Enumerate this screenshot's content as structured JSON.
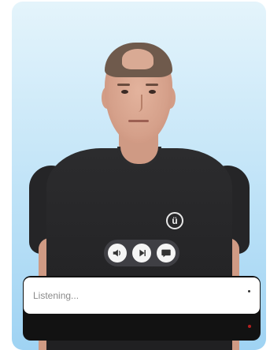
{
  "chat": {
    "input_placeholder": "Listening..."
  },
  "shirt_logo": {
    "glyph": "ü"
  },
  "controls": {
    "buttons": [
      {
        "name": "speaker",
        "icon": "speaker-icon"
      },
      {
        "name": "play",
        "icon": "play-icon"
      },
      {
        "name": "chat",
        "icon": "chat-bubble-icon"
      }
    ]
  },
  "colors": {
    "background_top": "#e4f4fb",
    "background_bottom": "#9fd3f3",
    "shirt": "#2c2c2e",
    "panel": "#121212",
    "record_dot": "#b52020"
  }
}
